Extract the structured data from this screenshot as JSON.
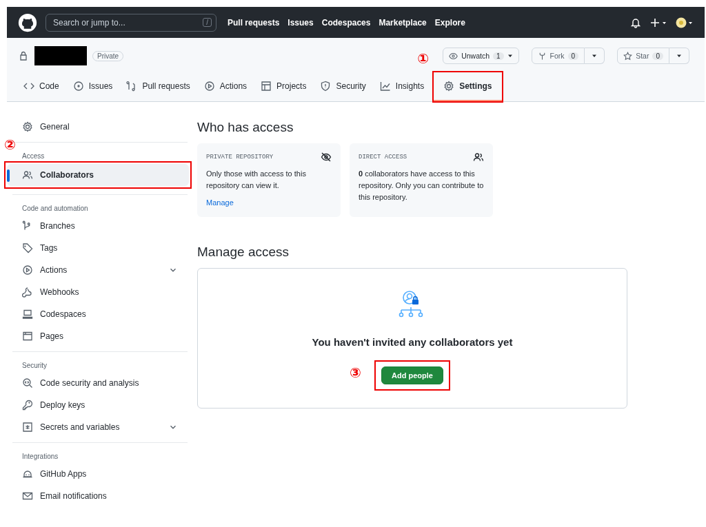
{
  "header": {
    "search": {
      "placeholder": "Search or jump to...",
      "shortcut": "/"
    },
    "nav": [
      "Pull requests",
      "Issues",
      "Codespaces",
      "Marketplace",
      "Explore"
    ]
  },
  "repo": {
    "visibility": "Private",
    "actions": [
      {
        "label": "Unwatch",
        "count": "1",
        "split": false
      },
      {
        "label": "Fork",
        "count": "0",
        "split": true
      },
      {
        "label": "Star",
        "count": "0",
        "split": true
      }
    ],
    "tabs": [
      {
        "label": "Code",
        "selected": false
      },
      {
        "label": "Issues",
        "selected": false
      },
      {
        "label": "Pull requests",
        "selected": false
      },
      {
        "label": "Actions",
        "selected": false
      },
      {
        "label": "Projects",
        "selected": false
      },
      {
        "label": "Security",
        "selected": false
      },
      {
        "label": "Insights",
        "selected": false
      },
      {
        "label": "Settings",
        "selected": true,
        "callout": "①"
      }
    ]
  },
  "sidebar": {
    "sections": [
      {
        "items": [
          {
            "label": "General",
            "selected": false,
            "expandable": false
          }
        ]
      },
      {
        "heading": "Access",
        "items": [
          {
            "label": "Collaborators",
            "selected": true,
            "expandable": false,
            "callout": "②"
          }
        ]
      },
      {
        "heading": "Code and automation",
        "items": [
          {
            "label": "Branches",
            "selected": false,
            "expandable": false
          },
          {
            "label": "Tags",
            "selected": false,
            "expandable": false
          },
          {
            "label": "Actions",
            "selected": false,
            "expandable": true
          },
          {
            "label": "Webhooks",
            "selected": false,
            "expandable": false
          },
          {
            "label": "Codespaces",
            "selected": false,
            "expandable": false
          },
          {
            "label": "Pages",
            "selected": false,
            "expandable": false
          }
        ]
      },
      {
        "heading": "Security",
        "items": [
          {
            "label": "Code security and analysis",
            "selected": false,
            "expandable": false
          },
          {
            "label": "Deploy keys",
            "selected": false,
            "expandable": false
          },
          {
            "label": "Secrets and variables",
            "selected": false,
            "expandable": true
          }
        ]
      },
      {
        "heading": "Integrations",
        "items": [
          {
            "label": "GitHub Apps",
            "selected": false,
            "expandable": false
          },
          {
            "label": "Email notifications",
            "selected": false,
            "expandable": false
          }
        ]
      }
    ]
  },
  "who_has_access": {
    "title": "Who has access",
    "cards": [
      {
        "label": "PRIVATE REPOSITORY",
        "text": "Only those with access to this repository can view it.",
        "link": "Manage"
      },
      {
        "label": "DIRECT ACCESS",
        "text": "**0** collaborators have access to this repository. Only you can contribute to this repository."
      }
    ]
  },
  "manage_access": {
    "title": "Manage access",
    "empty_text": "You haven't invited any collaborators yet",
    "button": {
      "label": "Add people",
      "callout": "③"
    }
  }
}
